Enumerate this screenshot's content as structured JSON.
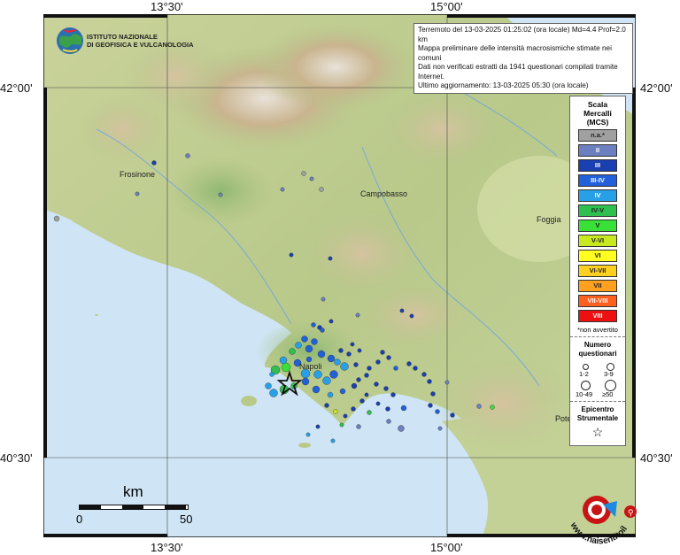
{
  "axes": {
    "top_ticks": [
      "13°30'",
      "15°00'"
    ],
    "bottom_ticks": [
      "13°30'",
      "15°00'"
    ],
    "left_ticks": [
      "42°00'",
      "40°30'"
    ],
    "right_ticks": [
      "42°00'",
      "40°30'"
    ]
  },
  "header_info": {
    "line1": "Terremoto del 13-03-2025 01:25:02 (ora locale) Md=4.4 Prof=2.0 km",
    "line2": "Mappa preliminare delle intensità macrosismiche stimate nei comuni",
    "line3": "Dati non verificati estratti da 1941 questionari compilati tramite Internet.",
    "line4": "Ultimo aggiornamento: 13-03-2025 05:30 (ora locale)"
  },
  "logo": {
    "line1": "ISTITUTO NAZIONALE",
    "line2": "DI GEOFISICA E VULCANOLOGIA"
  },
  "cities": {
    "frosinone": "Frosinone",
    "campobasso": "Campobasso",
    "foggia": "Foggia",
    "napoli": "Napoli",
    "potenza": "Potenza"
  },
  "legend": {
    "title1": "Scala",
    "title2": "Mercalli",
    "title3": "(MCS)",
    "items": [
      {
        "label": "n.a.*",
        "color": "#a0a0a0"
      },
      {
        "label": "II",
        "color": "#6c7fc0"
      },
      {
        "label": "III",
        "color": "#1a3fb0"
      },
      {
        "label": "III-IV",
        "color": "#2060d8"
      },
      {
        "label": "IV",
        "color": "#28a0e8"
      },
      {
        "label": "IV-V",
        "color": "#30c050"
      },
      {
        "label": "V",
        "color": "#38e038"
      },
      {
        "label": "V-VI",
        "color": "#c8e820"
      },
      {
        "label": "VI",
        "color": "#ffff20"
      },
      {
        "label": "VI-VII",
        "color": "#ffd020"
      },
      {
        "label": "VII",
        "color": "#ffa020"
      },
      {
        "label": "VII-VIII",
        "color": "#ff6020"
      },
      {
        "label": "VIII",
        "color": "#ee1010"
      }
    ],
    "note": "*non avvertito",
    "questionari_title1": "Numero",
    "questionari_title2": "questionari",
    "size_labels": [
      "1-2",
      "3-9",
      "10-49",
      "≥50"
    ],
    "epicentro_title1": "Epicentro",
    "epicentro_title2": "Strumentale",
    "star_symbol": "☆"
  },
  "scale": {
    "title": "km",
    "start": "0",
    "end": "50"
  },
  "badge": {
    "text": "www.haisentitoilterremoto.it"
  }
}
